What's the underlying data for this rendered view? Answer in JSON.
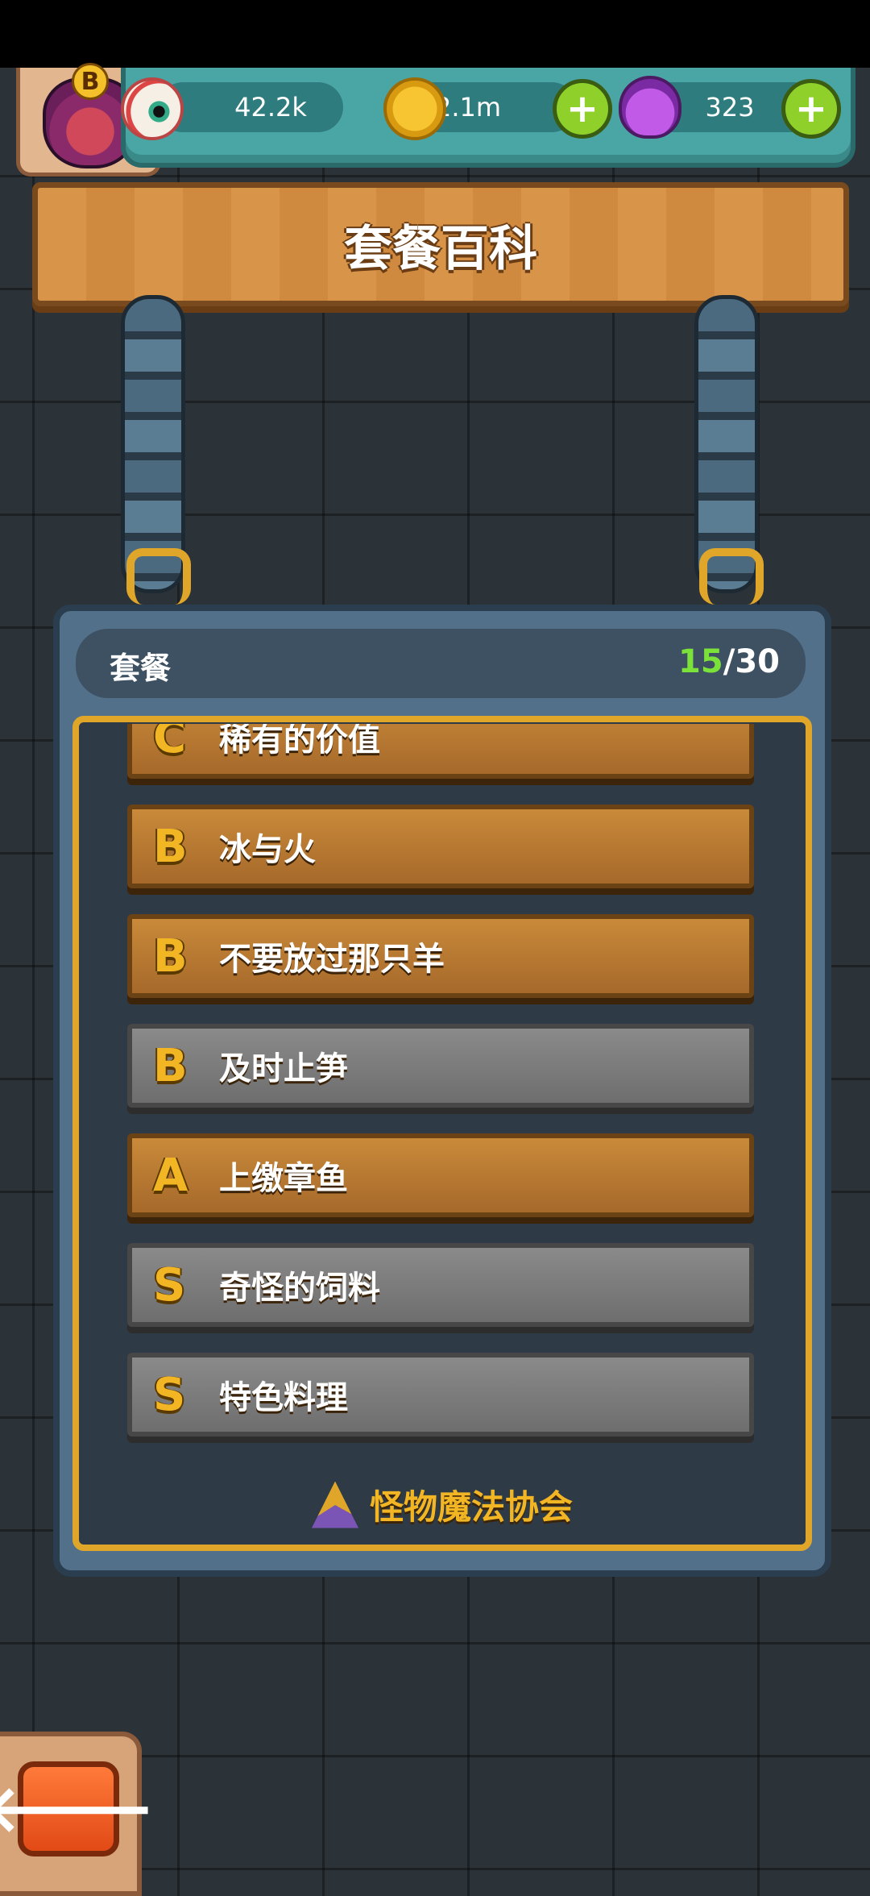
{
  "resources": [
    {
      "icon": "eye-icon",
      "value": "42.2k",
      "has_plus": false
    },
    {
      "icon": "gold-coin-icon",
      "value": "2.1m",
      "has_plus": true
    },
    {
      "icon": "purple-potion-icon",
      "value": "323",
      "has_plus": true
    }
  ],
  "player_badge": {
    "rank": "B",
    "icon": "monster-avatar-icon"
  },
  "title": "套餐百科",
  "board": {
    "header_label": "套餐",
    "progress_current": "15",
    "progress_total": "/30"
  },
  "recipes": [
    {
      "rank": "C",
      "name": "稀有的价值",
      "state": "unlocked"
    },
    {
      "rank": "B",
      "name": "冰与火",
      "state": "unlocked"
    },
    {
      "rank": "B",
      "name": "不要放过那只羊",
      "state": "unlocked"
    },
    {
      "rank": "B",
      "name": "及时止笋",
      "state": "locked"
    },
    {
      "rank": "A",
      "name": "上缴章鱼",
      "state": "unlocked"
    },
    {
      "rank": "S",
      "name": "奇怪的饲料",
      "state": "locked"
    },
    {
      "rank": "S",
      "name": "特色料理",
      "state": "locked"
    }
  ],
  "footer": {
    "society_label": "怪物魔法协会",
    "icon": "triangle-eye-icon"
  },
  "back_button": {
    "icon": "back-arrow-icon",
    "glyph": "🡐"
  },
  "colors": {
    "progress_current": "#7be23a",
    "rank_letter": "#f2b625",
    "frame_gold": "#e0a62a"
  }
}
